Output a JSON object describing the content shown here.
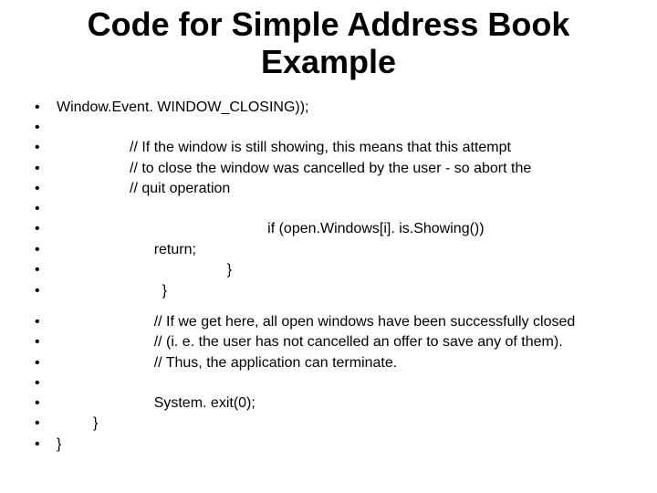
{
  "title": "Code for Simple Address Book Example",
  "lines_a": [
    "Window.Event. WINDOW_CLOSING));",
    "",
    "                  // If the window is still showing, this means that this attempt",
    "                  // to close the window was cancelled by the user - so abort the",
    "                  // quit operation",
    "",
    "                                                    if (open.Windows[i]. is.Showing())",
    "                        return;",
    "                                          }",
    "                          }"
  ],
  "lines_b": [
    "                        // If we get here, all open windows have been successfully closed",
    "                        // (i. e. the user has not cancelled an offer to save any of them).",
    "                        // Thus, the application can terminate.",
    "",
    "                        System. exit(0);",
    "         }",
    "}"
  ]
}
